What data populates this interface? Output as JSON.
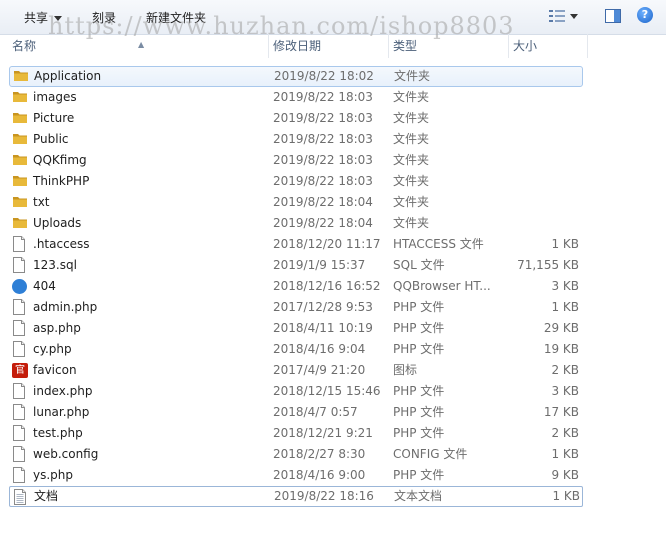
{
  "toolbar": {
    "share_label": "共享",
    "burn_label": "刻录",
    "new_folder_label": "新建文件夹",
    "watermark": "https://www.huzhan.com/ishop8803"
  },
  "columns": {
    "name": "名称",
    "date": "修改日期",
    "type": "类型",
    "size": "大小"
  },
  "files": [
    {
      "name": "Application",
      "date": "2019/8/22 18:02",
      "type": "文件夹",
      "size": "",
      "icon": "folder-icon"
    },
    {
      "name": "images",
      "date": "2019/8/22 18:03",
      "type": "文件夹",
      "size": "",
      "icon": "folder-icon"
    },
    {
      "name": "Picture",
      "date": "2019/8/22 18:03",
      "type": "文件夹",
      "size": "",
      "icon": "folder-icon"
    },
    {
      "name": "Public",
      "date": "2019/8/22 18:03",
      "type": "文件夹",
      "size": "",
      "icon": "folder-icon"
    },
    {
      "name": "QQKfimg",
      "date": "2019/8/22 18:03",
      "type": "文件夹",
      "size": "",
      "icon": "folder-icon"
    },
    {
      "name": "ThinkPHP",
      "date": "2019/8/22 18:03",
      "type": "文件夹",
      "size": "",
      "icon": "folder-icon"
    },
    {
      "name": "txt",
      "date": "2019/8/22 18:04",
      "type": "文件夹",
      "size": "",
      "icon": "folder-icon"
    },
    {
      "name": "Uploads",
      "date": "2019/8/22 18:04",
      "type": "文件夹",
      "size": "",
      "icon": "folder-icon"
    },
    {
      "name": ".htaccess",
      "date": "2018/12/20 11:17",
      "type": "HTACCESS 文件",
      "size": "1 KB",
      "icon": "file-icon"
    },
    {
      "name": "123.sql",
      "date": "2019/1/9 15:37",
      "type": "SQL 文件",
      "size": "71,155 KB",
      "icon": "file-icon"
    },
    {
      "name": "404",
      "date": "2018/12/16 16:52",
      "type": "QQBrowser HT...",
      "size": "3 KB",
      "icon": "qqbrowser-icon"
    },
    {
      "name": "admin.php",
      "date": "2017/12/28 9:53",
      "type": "PHP 文件",
      "size": "1 KB",
      "icon": "file-icon"
    },
    {
      "name": "asp.php",
      "date": "2018/4/11 10:19",
      "type": "PHP 文件",
      "size": "29 KB",
      "icon": "file-icon"
    },
    {
      "name": "cy.php",
      "date": "2018/4/16 9:04",
      "type": "PHP 文件",
      "size": "19 KB",
      "icon": "file-icon"
    },
    {
      "name": "favicon",
      "date": "2017/4/9 21:20",
      "type": "图标",
      "size": "2 KB",
      "icon": "favicon-icon"
    },
    {
      "name": "index.php",
      "date": "2018/12/15 15:46",
      "type": "PHP 文件",
      "size": "3 KB",
      "icon": "file-icon"
    },
    {
      "name": "lunar.php",
      "date": "2018/4/7 0:57",
      "type": "PHP 文件",
      "size": "17 KB",
      "icon": "file-icon"
    },
    {
      "name": "test.php",
      "date": "2018/12/21 9:21",
      "type": "PHP 文件",
      "size": "2 KB",
      "icon": "file-icon"
    },
    {
      "name": "web.config",
      "date": "2018/2/27 8:30",
      "type": "CONFIG 文件",
      "size": "1 KB",
      "icon": "file-icon"
    },
    {
      "name": "ys.php",
      "date": "2018/4/16 9:00",
      "type": "PHP 文件",
      "size": "9 KB",
      "icon": "file-icon"
    },
    {
      "name": "文档",
      "date": "2019/8/22 18:16",
      "type": "文本文档",
      "size": "1 KB",
      "icon": "text-document-icon"
    }
  ],
  "favicon_glyph": "官",
  "colors": {
    "folder": "#e8b93a",
    "folder_dark": "#c99520",
    "selection_border": "#a9c8ec",
    "header_text": "#4c607a"
  }
}
